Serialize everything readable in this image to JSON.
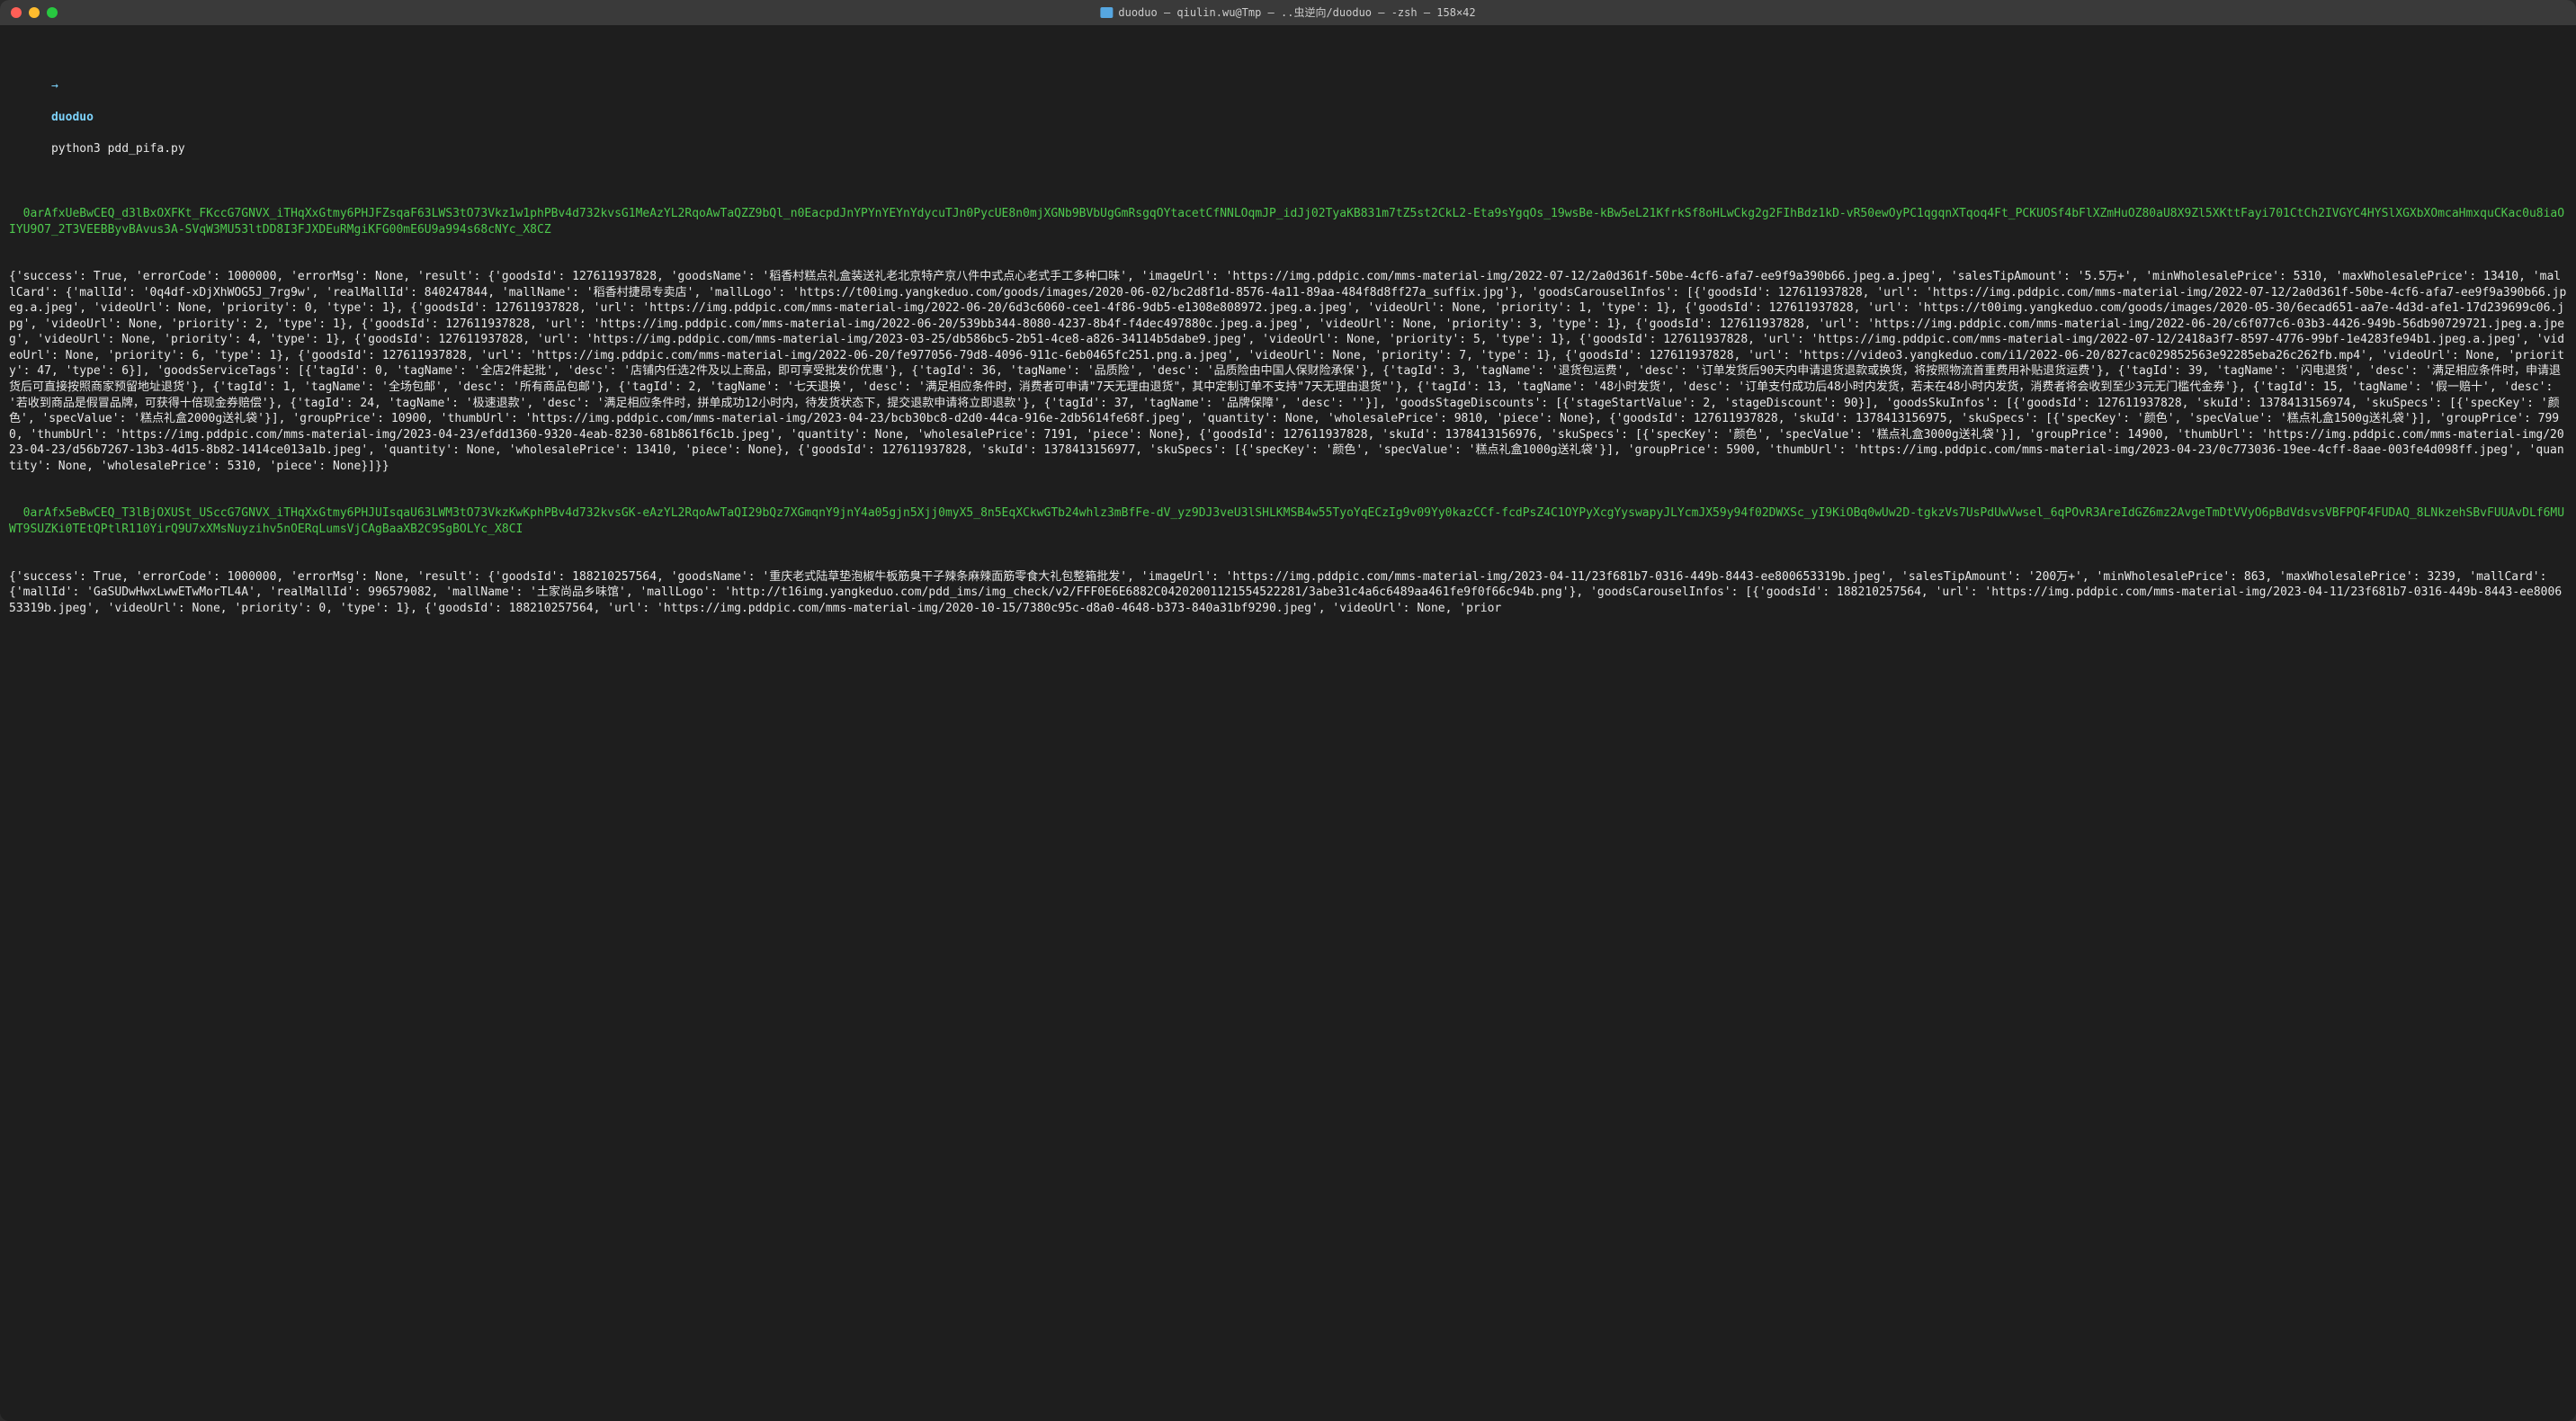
{
  "window": {
    "title": "duoduo — qiulin.wu@Tmp — ..虫逆向/duoduo — -zsh — 158×42"
  },
  "prompt": {
    "arrow": "→",
    "dir": "duoduo",
    "command": "python3 pdd_pifa.py"
  },
  "block1": {
    "token": "  0arAfxUeBwCEQ_d3lBxOXFKt_FKccG7GNVX_iTHqXxGtmy6PHJFZsqaF63LWS3tO73Vkz1w1phPBv4d732kvsG1MeAzYL2RqoAwTaQZZ9bQl_n0EacpdJnYPYnYEYnYdycuTJn0PycUE8n0mjXGNb9BVbUgGmRsgqOYtacetCfNNLOqmJP_idJj02TyaKB831m7tZ5st2CkL2-Eta9sYgqOs_19wsBe-kBw5eL21KfrkSf8oHLwCkg2g2FIhBdz1kD-vR50ewOyPC1qgqnXTqoq4Ft_PCKUOSf4bFlXZmHuOZ80aU8X9Zl5XKttFayi701CtCh2IVGYC4HYSlXGXbXOmcaHmxquCKac0u8iaOIYU9O7_2T3VEEBByvBAvus3A-SVqW3MU53ltDD8I3FJXDEuRMgiKFG00mE6U9a994s68cNYc_X8CZ",
    "output": "{'success': True, 'errorCode': 1000000, 'errorMsg': None, 'result': {'goodsId': 127611937828, 'goodsName': '稻香村糕点礼盒装送礼老北京特产京八件中式点心老式手工多种口味', 'imageUrl': 'https://img.pddpic.com/mms-material-img/2022-07-12/2a0d361f-50be-4cf6-afa7-ee9f9a390b66.jpeg.a.jpeg', 'salesTipAmount': '5.5万+', 'minWholesalePrice': 5310, 'maxWholesalePrice': 13410, 'mallCard': {'mallId': '0q4df-xDjXhWOG5J_7rg9w', 'realMallId': 840247844, 'mallName': '稻香村捷昂专卖店', 'mallLogo': 'https://t00img.yangkeduo.com/goods/images/2020-06-02/bc2d8f1d-8576-4a11-89aa-484f8d8ff27a_suffix.jpg'}, 'goodsCarouselInfos': [{'goodsId': 127611937828, 'url': 'https://img.pddpic.com/mms-material-img/2022-07-12/2a0d361f-50be-4cf6-afa7-ee9f9a390b66.jpeg.a.jpeg', 'videoUrl': None, 'priority': 0, 'type': 1}, {'goodsId': 127611937828, 'url': 'https://img.pddpic.com/mms-material-img/2022-06-20/6d3c6060-cee1-4f86-9db5-e1308e808972.jpeg.a.jpeg', 'videoUrl': None, 'priority': 1, 'type': 1}, {'goodsId': 127611937828, 'url': 'https://t00img.yangkeduo.com/goods/images/2020-05-30/6ecad651-aa7e-4d3d-afe1-17d239699c06.jpg', 'videoUrl': None, 'priority': 2, 'type': 1}, {'goodsId': 127611937828, 'url': 'https://img.pddpic.com/mms-material-img/2022-06-20/539bb344-8080-4237-8b4f-f4dec497880c.jpeg.a.jpeg', 'videoUrl': None, 'priority': 3, 'type': 1}, {'goodsId': 127611937828, 'url': 'https://img.pddpic.com/mms-material-img/2022-06-20/c6f077c6-03b3-4426-949b-56db90729721.jpeg.a.jpeg', 'videoUrl': None, 'priority': 4, 'type': 1}, {'goodsId': 127611937828, 'url': 'https://img.pddpic.com/mms-material-img/2023-03-25/db586bc5-2b51-4ce8-a826-34114b5dabe9.jpeg', 'videoUrl': None, 'priority': 5, 'type': 1}, {'goodsId': 127611937828, 'url': 'https://img.pddpic.com/mms-material-img/2022-07-12/2418a3f7-8597-4776-99bf-1e4283fe94b1.jpeg.a.jpeg', 'videoUrl': None, 'priority': 6, 'type': 1}, {'goodsId': 127611937828, 'url': 'https://img.pddpic.com/mms-material-img/2022-06-20/fe977056-79d8-4096-911c-6eb0465fc251.png.a.jpeg', 'videoUrl': None, 'priority': 7, 'type': 1}, {'goodsId': 127611937828, 'url': 'https://video3.yangkeduo.com/i1/2022-06-20/827cac029852563e92285eba26c262fb.mp4', 'videoUrl': None, 'priority': 47, 'type': 6}], 'goodsServiceTags': [{'tagId': 0, 'tagName': '全店2件起批', 'desc': '店铺内任选2件及以上商品，即可享受批发价优惠'}, {'tagId': 36, 'tagName': '品质险', 'desc': '品质险由中国人保财险承保'}, {'tagId': 3, 'tagName': '退货包运费', 'desc': '订单发货后90天内申请退货退款或换货，将按照物流首重费用补贴退货运费'}, {'tagId': 39, 'tagName': '闪电退货', 'desc': '满足相应条件时，申请退货后可直接按照商家预留地址退货'}, {'tagId': 1, 'tagName': '全场包邮', 'desc': '所有商品包邮'}, {'tagId': 2, 'tagName': '七天退换', 'desc': '满足相应条件时，消费者可申请\"7天无理由退货\"，其中定制订单不支持\"7天无理由退货\"'}, {'tagId': 13, 'tagName': '48小时发货', 'desc': '订单支付成功后48小时内发货，若未在48小时内发货，消费者将会收到至少3元无门槛代金券'}, {'tagId': 15, 'tagName': '假一赔十', 'desc': '若收到商品是假冒品牌，可获得十倍现金券赔偿'}, {'tagId': 24, 'tagName': '极速退款', 'desc': '满足相应条件时，拼单成功12小时内，待发货状态下，提交退款申请将立即退款'}, {'tagId': 37, 'tagName': '品牌保障', 'desc': ''}], 'goodsStageDiscounts': [{'stageStartValue': 2, 'stageDiscount': 90}], 'goodsSkuInfos': [{'goodsId': 127611937828, 'skuId': 1378413156974, 'skuSpecs': [{'specKey': '颜色', 'specValue': '糕点礼盒2000g送礼袋'}], 'groupPrice': 10900, 'thumbUrl': 'https://img.pddpic.com/mms-material-img/2023-04-23/bcb30bc8-d2d0-44ca-916e-2db5614fe68f.jpeg', 'quantity': None, 'wholesalePrice': 9810, 'piece': None}, {'goodsId': 127611937828, 'skuId': 1378413156975, 'skuSpecs': [{'specKey': '颜色', 'specValue': '糕点礼盒1500g送礼袋'}], 'groupPrice': 7990, 'thumbUrl': 'https://img.pddpic.com/mms-material-img/2023-04-23/efdd1360-9320-4eab-8230-681b861f6c1b.jpeg', 'quantity': None, 'wholesalePrice': 7191, 'piece': None}, {'goodsId': 127611937828, 'skuId': 1378413156976, 'skuSpecs': [{'specKey': '颜色', 'specValue': '糕点礼盒3000g送礼袋'}], 'groupPrice': 14900, 'thumbUrl': 'https://img.pddpic.com/mms-material-img/2023-04-23/d56b7267-13b3-4d15-8b82-1414ce013a1b.jpeg', 'quantity': None, 'wholesalePrice': 13410, 'piece': None}, {'goodsId': 127611937828, 'skuId': 1378413156977, 'skuSpecs': [{'specKey': '颜色', 'specValue': '糕点礼盒1000g送礼袋'}], 'groupPrice': 5900, 'thumbUrl': 'https://img.pddpic.com/mms-material-img/2023-04-23/0c773036-19ee-4cff-8aae-003fe4d098ff.jpeg', 'quantity': None, 'wholesalePrice': 5310, 'piece': None}]}}"
  },
  "block2": {
    "token": "  0arAfx5eBwCEQ_T3lBjOXUSt_USccG7GNVX_iTHqXxGtmy6PHJUIsqaU63LWM3tO73VkzKwKphPBv4d732kvsGK-eAzYL2RqoAwTaQI29bQz7XGmqnY9jnY4a05gjn5Xjj0myX5_8n5EqXCkwGTb24whlz3mBfFe-dV_yz9DJ3veU3lSHLKMSB4w55TyoYqECzIg9v09Yy0kazCCf-fcdPsZ4C1OYPyXcgYyswapyJLYcmJX59y94f02DWXSc_yI9KiOBq0wUw2D-tgkzVs7UsPdUwVwsel_6qPOvR3AreIdGZ6mz2AvgeTmDtVVyO6pBdVdsvsVBFPQF4FUDAQ_8LNkzehSBvFUUAvDLf6MUWT9SUZKi0TEtQPtlR110YirQ9U7xXMsNuyzihv5nOERqLumsVjCAgBaaXB2C9SgBOLYc_X8CI",
    "output": "{'success': True, 'errorCode': 1000000, 'errorMsg': None, 'result': {'goodsId': 188210257564, 'goodsName': '重庆老式陆草垫泡椒牛板筋臭干子辣条麻辣面筋零食大礼包整箱批发', 'imageUrl': 'https://img.pddpic.com/mms-material-img/2023-04-11/23f681b7-0316-449b-8443-ee800653319b.jpeg', 'salesTipAmount': '200万+', 'minWholesalePrice': 863, 'maxWholesalePrice': 3239, 'mallCard': {'mallId': 'GaSUDwHwxLwwETwMorTL4A', 'realMallId': 996579082, 'mallName': '土家尚品乡味馆', 'mallLogo': 'http://t16img.yangkeduo.com/pdd_ims/img_check/v2/FFF0E6E6882C04202001121554522281/3abe31c4a6c6489aa461fe9f0f66c94b.png'}, 'goodsCarouselInfos': [{'goodsId': 188210257564, 'url': 'https://img.pddpic.com/mms-material-img/2023-04-11/23f681b7-0316-449b-8443-ee800653319b.jpeg', 'videoUrl': None, 'priority': 0, 'type': 1}, {'goodsId': 188210257564, 'url': 'https://img.pddpic.com/mms-material-img/2020-10-15/7380c95c-d8a0-4648-b373-840a31bf9290.jpeg', 'videoUrl': None, 'prior"
  }
}
